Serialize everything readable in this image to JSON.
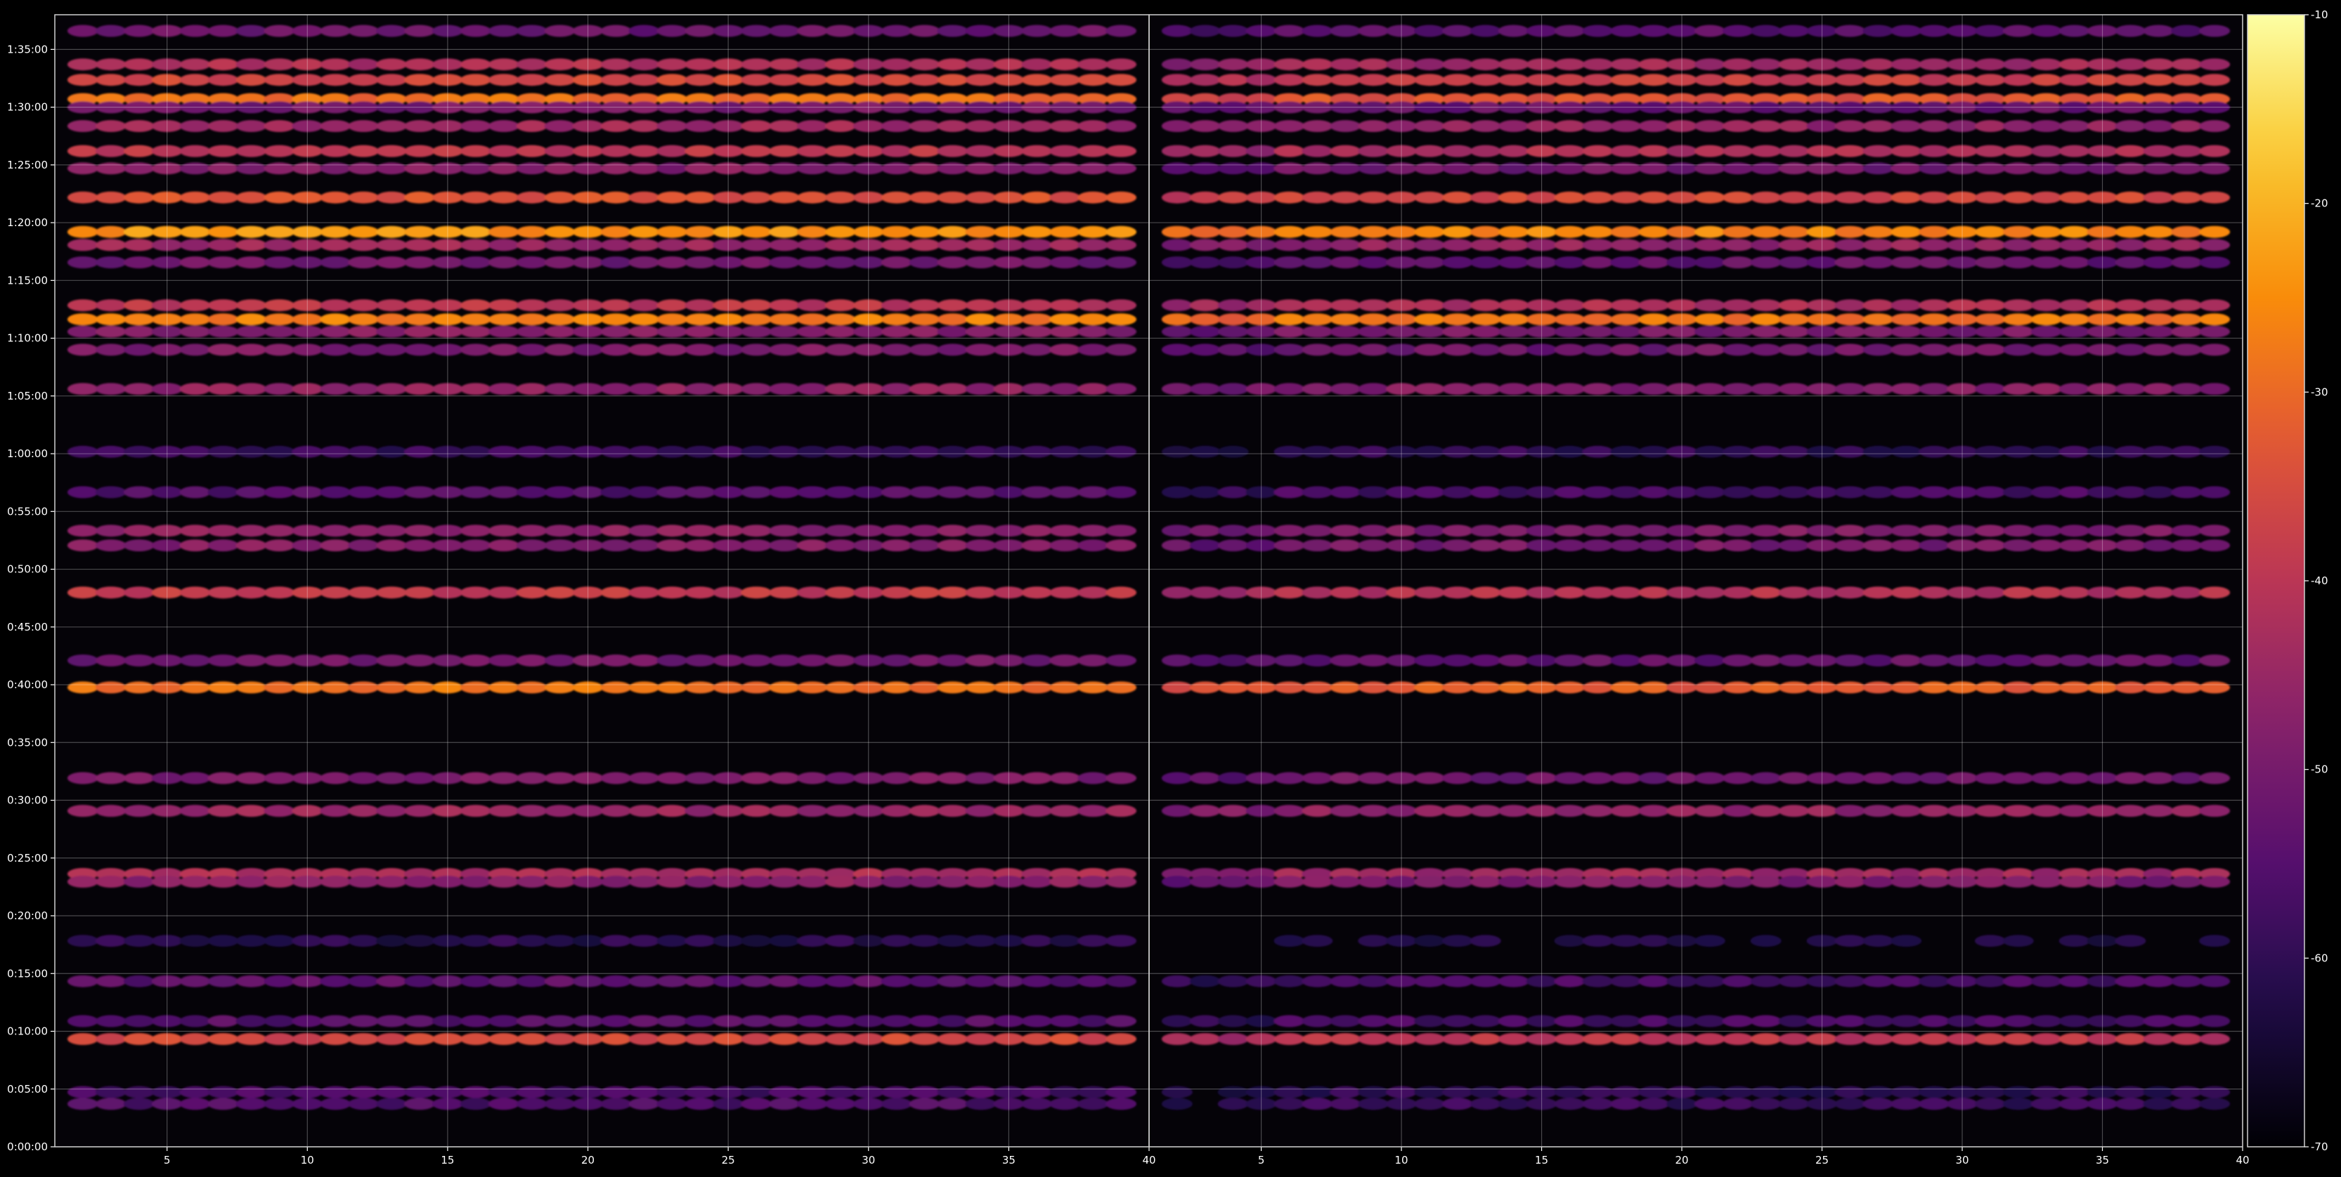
{
  "chart_data": {
    "type": "heatmap",
    "title": "",
    "xlabel": "",
    "ylabel": "",
    "panels": [
      {
        "xlim": [
          1,
          40
        ],
        "ylim_seconds": [
          0,
          5880
        ]
      },
      {
        "xlim": [
          1,
          40
        ],
        "ylim_seconds": [
          0,
          5880
        ]
      }
    ],
    "x_ticks": [
      5,
      10,
      15,
      20,
      25,
      30,
      35,
      40
    ],
    "x_tick_labels": [
      "5",
      "10",
      "15",
      "20",
      "25",
      "30",
      "35",
      "40"
    ],
    "y_ticks_seconds": [
      0,
      300,
      600,
      900,
      1200,
      1500,
      1800,
      2100,
      2400,
      2700,
      3000,
      3300,
      3600,
      3900,
      4200,
      4500,
      4800,
      5100,
      5400,
      5700
    ],
    "y_tick_labels": [
      "0:00:00",
      "0:05:00",
      "0:10:00",
      "0:15:00",
      "0:20:00",
      "0:25:00",
      "0:30:00",
      "0:35:00",
      "0:40:00",
      "0:45:00",
      "0:50:00",
      "0:55:00",
      "1:00:00",
      "1:05:00",
      "1:10:00",
      "1:15:00",
      "1:20:00",
      "1:25:00",
      "1:30:00",
      "1:35:00"
    ],
    "grid": true,
    "colormap": "inferno",
    "colorbar": {
      "range": [
        -70,
        -10
      ],
      "ticks": [
        -10,
        -20,
        -30,
        -40,
        -50,
        -60,
        -70
      ],
      "tick_labels": [
        "-10",
        "-20",
        "-30",
        "-40",
        "-50",
        "-60",
        "-70"
      ]
    },
    "rows": [
      {
        "t": 5796,
        "left": -52,
        "right": -54
      },
      {
        "t": 5622,
        "left": -42,
        "right": -44
      },
      {
        "t": 5542,
        "left": -36,
        "right": -38
      },
      {
        "t": 5442,
        "left": -29,
        "right": -33
      },
      {
        "t": 5399,
        "left": -50,
        "right": -52
      },
      {
        "t": 5302,
        "left": -44,
        "right": -46
      },
      {
        "t": 5172,
        "left": -40,
        "right": -42
      },
      {
        "t": 5082,
        "left": -48,
        "right": -51
      },
      {
        "t": 4931,
        "left": -34,
        "right": -36
      },
      {
        "t": 4752,
        "left": -24,
        "right": -26
      },
      {
        "t": 4684,
        "left": -44,
        "right": -46
      },
      {
        "t": 4594,
        "left": -51,
        "right": -53
      },
      {
        "t": 4371,
        "left": -40,
        "right": -42
      },
      {
        "t": 4298,
        "left": -27,
        "right": -28
      },
      {
        "t": 4234,
        "left": -48,
        "right": -50
      },
      {
        "t": 4140,
        "left": -49,
        "right": -51
      },
      {
        "t": 3936,
        "left": -46,
        "right": -48
      },
      {
        "t": 3610,
        "left": -59,
        "right": -60
      },
      {
        "t": 3400,
        "left": -55,
        "right": -57
      },
      {
        "t": 3200,
        "left": -47,
        "right": -49
      },
      {
        "t": 3124,
        "left": -48,
        "right": -50
      },
      {
        "t": 2879,
        "left": -39,
        "right": -41
      },
      {
        "t": 2526,
        "left": -51,
        "right": -53
      },
      {
        "t": 2386,
        "left": -28,
        "right": -32
      },
      {
        "t": 1915,
        "left": -49,
        "right": -51
      },
      {
        "t": 1745,
        "left": -45,
        "right": -46
      },
      {
        "t": 1417,
        "left": -42,
        "right": -44
      },
      {
        "t": 1377,
        "left": -47,
        "right": -49
      },
      {
        "t": 1070,
        "left": -61,
        "right": -63
      },
      {
        "t": 860,
        "left": -54,
        "right": -57
      },
      {
        "t": 653,
        "left": -55,
        "right": -57
      },
      {
        "t": 560,
        "left": -36,
        "right": -40
      },
      {
        "t": 284,
        "left": -57,
        "right": -60
      },
      {
        "t": 223,
        "left": -56,
        "right": -59
      }
    ]
  }
}
